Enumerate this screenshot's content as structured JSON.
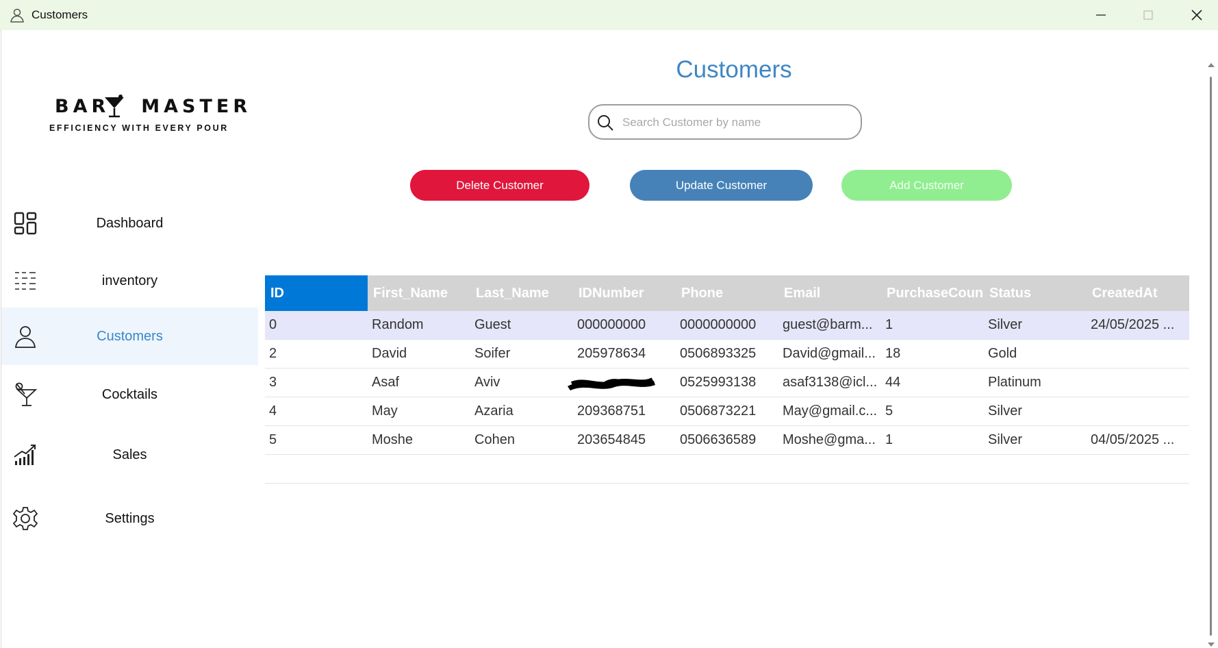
{
  "window": {
    "title": "Customers",
    "app_icon": "person-icon",
    "controls": [
      "minimize-icon",
      "maximize-icon",
      "close-icon"
    ]
  },
  "logo": {
    "word1": "BAR",
    "word2": "MASTER",
    "tagline": "EFFICIENCY WITH EVERY POUR",
    "icon": "cocktail-glass-icon"
  },
  "sidebar": {
    "items": [
      {
        "label": "Dashboard",
        "icon": "dashboard-grid-icon",
        "active": false
      },
      {
        "label": "inventory",
        "icon": "list-icon",
        "active": false
      },
      {
        "label": "Customers",
        "icon": "person-icon",
        "active": true
      },
      {
        "label": "Cocktails",
        "icon": "cocktail-icon",
        "active": false
      },
      {
        "label": "Sales",
        "icon": "sales-chart-icon",
        "active": false
      },
      {
        "label": "Settings",
        "icon": "gear-icon",
        "active": false
      }
    ]
  },
  "main": {
    "title": "Customers",
    "search": {
      "placeholder": "Search Customer by name",
      "value": ""
    },
    "buttons": {
      "delete": "Delete Customer",
      "update": "Update Customer",
      "add": "Add Customer"
    }
  },
  "table": {
    "columns": [
      "ID",
      "First_Name",
      "Last_Name",
      "IDNumber",
      "Phone",
      "Email",
      "PurchaseCoun",
      "Status",
      "CreatedAt"
    ],
    "rows": [
      [
        "0",
        "Random",
        "Guest",
        "000000000",
        "0000000000",
        "guest@barm...",
        "1",
        "Silver",
        "24/05/2025 ..."
      ],
      [
        "2",
        "David",
        "Soifer",
        "205978634",
        "0506893325",
        "David@gmail...",
        "18",
        "Gold",
        ""
      ],
      [
        "3",
        "Asaf",
        "Aviv",
        "",
        "0525993138",
        "asaf3138@icl...",
        "44",
        "Platinum",
        ""
      ],
      [
        "4",
        "May",
        "Azaria",
        "209368751",
        "0506873221",
        "May@gmail.c...",
        "5",
        "Silver",
        ""
      ],
      [
        "5",
        "Moshe",
        "Cohen",
        "203654845",
        "0506636589",
        "Moshe@gma...",
        "1",
        "Silver",
        "04/05/2025 ..."
      ]
    ]
  },
  "colors": {
    "accent_blue": "#3f87c4",
    "delete_red": "#e0163c",
    "update_blue": "#4682b8",
    "add_green": "#90ee90",
    "header_selected": "#0078d7",
    "header_bg": "#d3d3d3",
    "selected_row": "#e6e6fa",
    "titlebar": "#ecf7e6"
  }
}
